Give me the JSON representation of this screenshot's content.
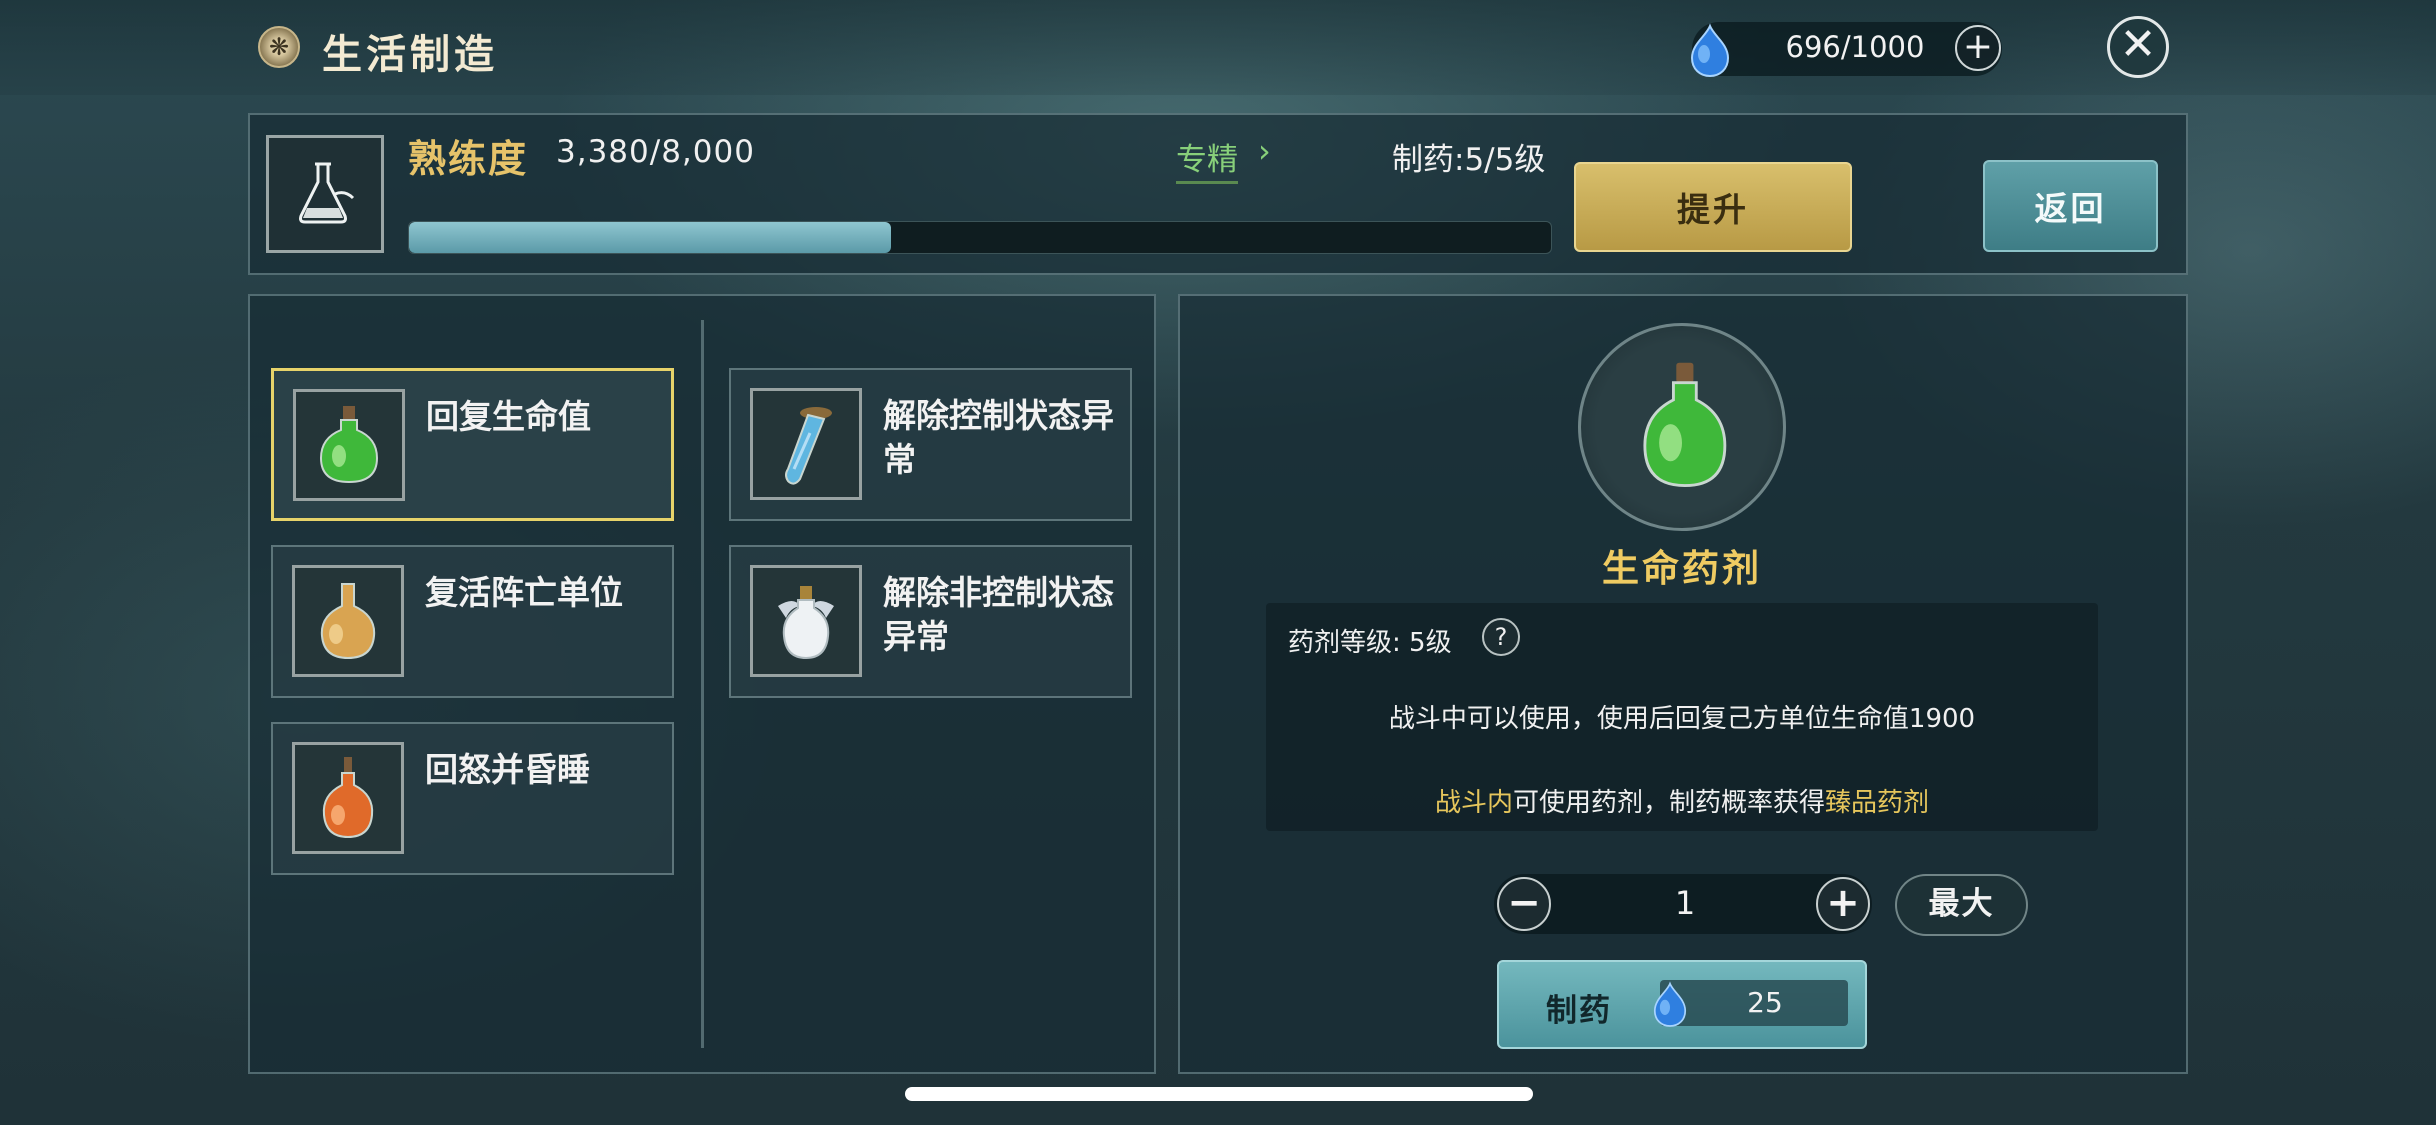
{
  "header": {
    "title": "生活制造",
    "resource": {
      "value": "696/1000",
      "plus_label": "+"
    },
    "close_label": "✕"
  },
  "proficiency": {
    "label": "熟练度",
    "value": "3,380/8,000",
    "progress_fraction": 0.4225,
    "specialize_label": "专精",
    "specialize_arrow": "›",
    "craft_level": "制药:5/5级",
    "upgrade_label": "提升",
    "back_label": "返回"
  },
  "potion_list": [
    {
      "name": "回复生命值",
      "icon": "green-potion-icon",
      "selected": true
    },
    {
      "name": "复活阵亡单位",
      "icon": "amber-potion-icon",
      "selected": false
    },
    {
      "name": "回怒并昏睡",
      "icon": "orange-potion-icon",
      "selected": false
    },
    {
      "name": "解除控制状态异常",
      "icon": "blue-vial-icon",
      "selected": false
    },
    {
      "name": "解除非控制状态异常",
      "icon": "white-winged-flask-icon",
      "selected": false
    }
  ],
  "detail": {
    "item_name": "生命药剂",
    "level_text": "药剂等级: 5级",
    "help_label": "?",
    "effect_text": "战斗中可以使用，使用后回复己方单位生命值1900",
    "bonus": {
      "part1": "战斗内",
      "part2": "可使用药剂，制药概率获得",
      "part3": "臻品药剂"
    },
    "quantity": "1",
    "minus_label": "−",
    "plus_label": "+",
    "max_label": "最大",
    "craft_label": "制药",
    "craft_cost": "25"
  },
  "colors": {
    "accent_gold": "#e6c65c",
    "link_green": "#88d07a",
    "selected_border": "#e7d36a",
    "bar_fill": "#5b9aa8"
  }
}
